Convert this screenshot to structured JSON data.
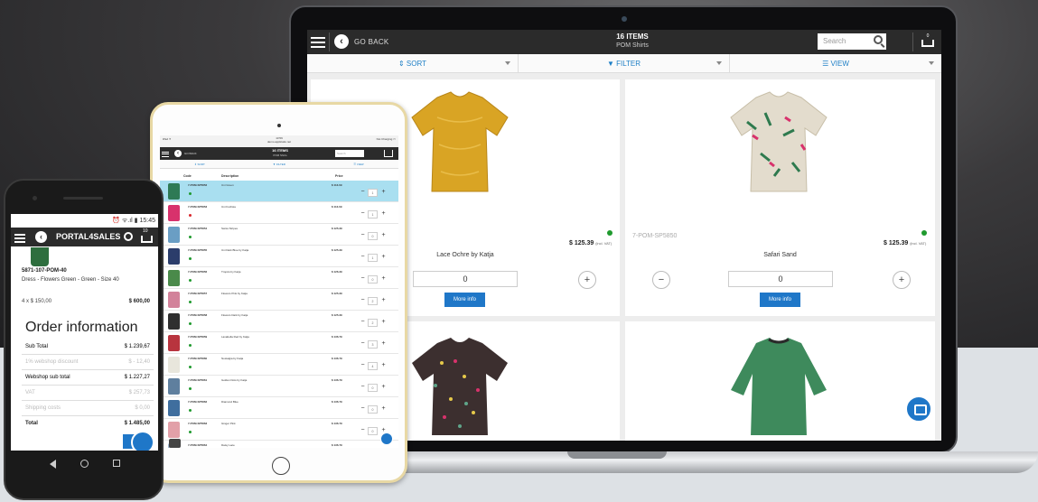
{
  "laptop": {
    "header": {
      "go_back": "GO BACK",
      "items_title": "16 ITEMS",
      "category": "POM Shirts",
      "search_placeholder": "Search",
      "cart_count": "0"
    },
    "toolbar": {
      "sort": "⇕ SORT",
      "filter": "▼ FILTER",
      "view": "☰ VIEW"
    },
    "products": [
      {
        "name": "Lace Ochre by Katja",
        "sku": "",
        "price": "$ 125.39",
        "price_note": "(incl. VAT)",
        "qty": "0",
        "more": "More info",
        "color": "#d9a424"
      },
      {
        "name": "Safari Sand",
        "sku": "7-POM-SP5850",
        "price": "$ 125.39",
        "price_note": "(incl. VAT)",
        "qty": "0",
        "more": "More info",
        "color": "#e3dccd"
      },
      {
        "name": "",
        "color": "#3c2f2f"
      },
      {
        "name": "",
        "color": "#3e8a5c"
      }
    ]
  },
  "tablet": {
    "status": {
      "left": "iPad ✈",
      "center": "13:59",
      "url": "demo.applicatio.net",
      "right": "Not Charging ▭"
    },
    "header": {
      "go_back": "GO BACK",
      "items_title": "16 ITEMS",
      "category": "POM Shirts",
      "search_placeholder": "Search",
      "cart_count": "0"
    },
    "toolbar": {
      "sort": "⇕ SORT",
      "filter": "▼ FILTER",
      "view": "☰ VIEW"
    },
    "columns": {
      "code": "Code",
      "description": "Description",
      "price": "Price"
    },
    "rows": [
      {
        "code": "7-POM-SP5852",
        "desc": "Uni Green",
        "price": "$ 113.09",
        "qty": "1",
        "swatch": "#2e7a55",
        "dot": "#1f9a2e",
        "selected": true
      },
      {
        "code": "7-POM-SP5853",
        "desc": "Uni Fuchsia",
        "price": "$ 113.09",
        "qty": "1",
        "swatch": "#d8326c",
        "dot": "#d9262c",
        "selected": false
      },
      {
        "code": "7-POM-SP5854",
        "desc": "Swiss Stripes",
        "price": "$ 125.39",
        "qty": "0",
        "swatch": "#6a9ec4",
        "dot": "#1f9a2e",
        "selected": false
      },
      {
        "code": "7-POM-SP5855",
        "desc": "Uni Dark Blue by Katja",
        "price": "$ 125.39",
        "qty": "1",
        "swatch": "#2b3d6b",
        "dot": "#1f9a2e",
        "selected": false
      },
      {
        "code": "7-POM-SP5856",
        "desc": "Tropics by Katja",
        "price": "$ 126.39",
        "qty": "0",
        "swatch": "#4a8a4a",
        "dot": "#1f9a2e",
        "selected": false
      },
      {
        "code": "7-POM-SP5857",
        "desc": "Flowers Pink by Katja",
        "price": "$ 125.39",
        "qty": "2",
        "swatch": "#d2829a",
        "dot": "#1f9a2e",
        "selected": false
      },
      {
        "code": "7-POM-SP5858",
        "desc": "Flowers Dark by Katja",
        "price": "$ 125.39",
        "qty": "2",
        "swatch": "#2f2f2f",
        "dot": "#1f9a2e",
        "selected": false
      },
      {
        "code": "7-POM-SP5859",
        "desc": "Lavabella Red by Katja",
        "price": "$ 136.79",
        "qty": "3",
        "swatch": "#b8343e",
        "dot": "#1f9a2e",
        "selected": false
      },
      {
        "code": "7-POM-SP5860",
        "desc": "Nostalgia by Katja",
        "price": "$ 136.79",
        "qty": "4",
        "swatch": "#e8e6dc",
        "dot": "#1f9a2e",
        "selected": false
      },
      {
        "code": "7-POM-SP5861",
        "desc": "Golden Dots by Katja",
        "price": "$ 136.79",
        "qty": "0",
        "swatch": "#5f7f9e",
        "dot": "#1f9a2e",
        "selected": false
      },
      {
        "code": "7-POM-SP5862",
        "desc": "Diamond Blue",
        "price": "$ 136.79",
        "qty": "0",
        "swatch": "#3f6e9e",
        "dot": "#1f9a2e",
        "selected": false
      },
      {
        "code": "7-POM-SP5863",
        "desc": "Ginger Pink",
        "price": "$ 136.79",
        "qty": "0",
        "swatch": "#e2a0a8",
        "dot": "#1f9a2e",
        "selected": false
      },
      {
        "code": "7-POM-SP5864",
        "desc": "Daisy Lace",
        "price": "$ 136.79",
        "qty": "0",
        "swatch": "#9fb6cf",
        "dot": "#1f9a2e",
        "selected": false
      }
    ]
  },
  "phone": {
    "status": "⏰ ᯤ.ıl ▮ 15:45",
    "brand": "PORTAL4SALES",
    "cart_count": "10",
    "product_sku": "5871-107-POM-40",
    "product_name": "Dress - Flowers Green - Green - Size 40",
    "line_qty": "4 x $ 150,00",
    "line_total": "$ 600,00",
    "order_heading": "Order information",
    "order_rows": [
      {
        "label": "Sub Total",
        "value": "$ 1.239,67",
        "style": "normal"
      },
      {
        "label": "1% webshop discount",
        "value": "$ - 12,40",
        "style": "muted"
      },
      {
        "label": "Webshop sub total",
        "value": "$ 1.227,27",
        "style": "normal"
      },
      {
        "label": "VAT",
        "value": "$ 257,73",
        "style": "muted"
      },
      {
        "label": "Shipping costs",
        "value": "$ 0,00",
        "style": "muted"
      },
      {
        "label": "Total",
        "value": "$ 1.485,00",
        "style": "bold"
      }
    ]
  }
}
